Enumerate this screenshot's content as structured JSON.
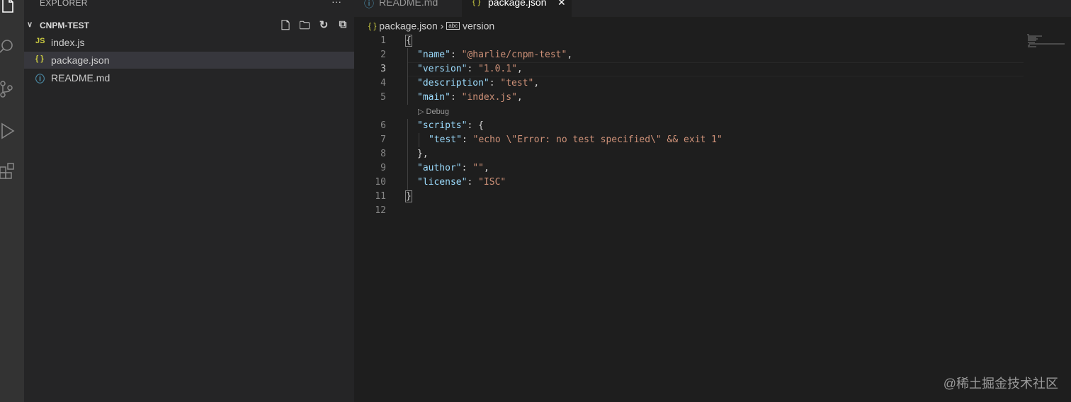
{
  "sidebar": {
    "title": "EXPLORER",
    "more": "···",
    "project": "CNPM-TEST",
    "files": [
      {
        "icon": "JS",
        "name": "index.js",
        "color": "#cbcb41"
      },
      {
        "icon": "{ }",
        "name": "package.json",
        "color": "#cbcb41"
      },
      {
        "icon": "ⓘ",
        "name": "README.md",
        "color": "#519aba"
      }
    ]
  },
  "tabs": [
    {
      "icon": "ⓘ",
      "label": "README.md"
    },
    {
      "icon": "{ }",
      "label": "package.json",
      "close": "✕"
    }
  ],
  "breadcrumb": {
    "file_icon": "{ }",
    "file": "package.json",
    "sep": "›",
    "symbol_icon": "abc",
    "symbol": "version"
  },
  "codelens": "▷ Debug",
  "lines": [
    "1",
    "2",
    "3",
    "4",
    "5",
    "6",
    "7",
    "8",
    "9",
    "10",
    "11",
    "12"
  ],
  "code": {
    "l1": "{",
    "l2k": "\"name\"",
    "l2v": "\"@harlie/cnpm-test\"",
    "l3k": "\"version\"",
    "l3v": "\"1.0.1\"",
    "l4k": "\"description\"",
    "l4v": "\"test\"",
    "l5k": "\"main\"",
    "l5v": "\"index.js\"",
    "l6k": "\"scripts\"",
    "l7k": "\"test\"",
    "l7v": "\"echo \\\"Error: no test specified\\\" && exit 1\"",
    "l9k": "\"author\"",
    "l9v": "\"\"",
    "l10k": "\"license\"",
    "l10v": "\"ISC\"",
    "l11": "}"
  },
  "watermark": "@稀土掘金技术社区"
}
